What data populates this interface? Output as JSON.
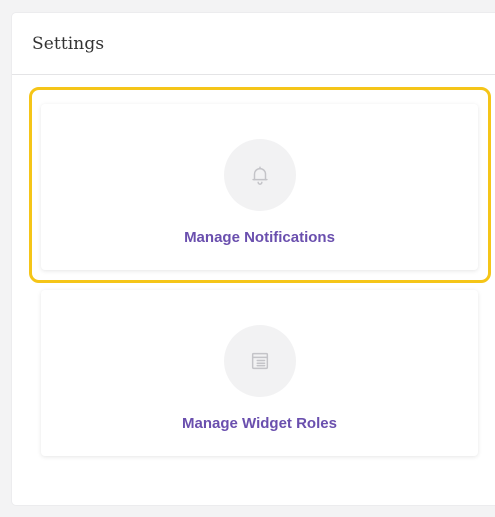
{
  "settings": {
    "title": "Settings",
    "cards": [
      {
        "label": "Manage Notifications",
        "icon": "bell-icon",
        "highlighted": true
      },
      {
        "label": "Manage Widget Roles",
        "icon": "widget-layout-icon",
        "highlighted": false
      }
    ]
  },
  "colors": {
    "accent_text": "#6a4fae",
    "highlight": "#f5c518",
    "icon_bg": "#f2f2f3",
    "icon_stroke": "#c4c4c8"
  }
}
